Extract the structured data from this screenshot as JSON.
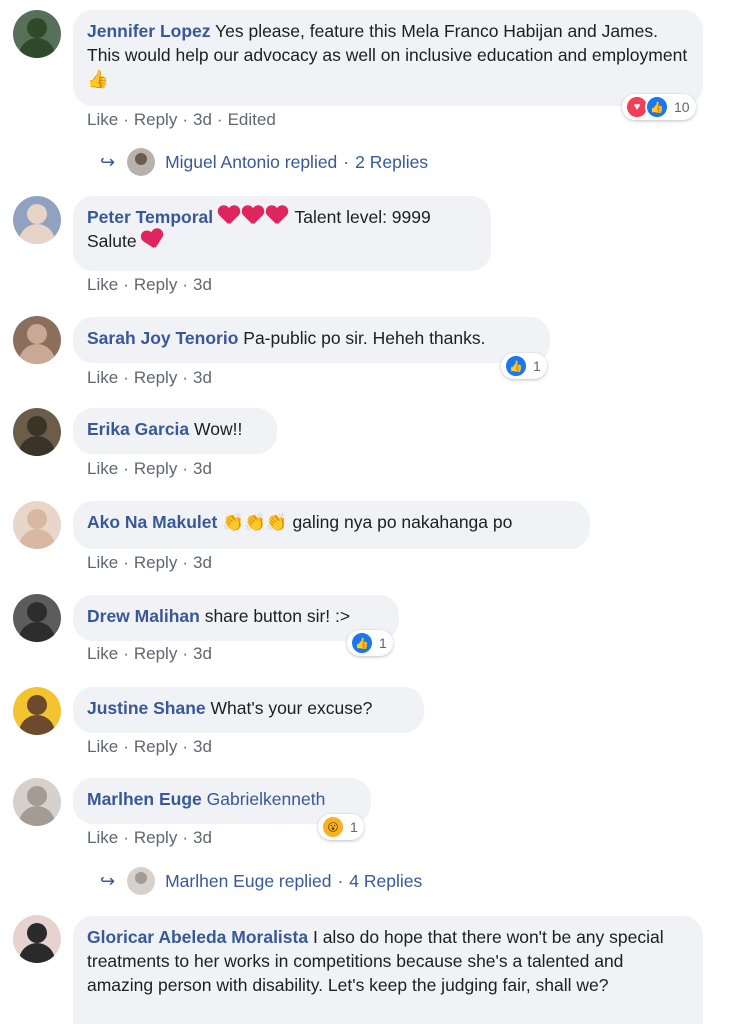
{
  "comments": [
    {
      "author": "Jennifer Lopez",
      "text": "Yes please, feature this Mela Franco Habijan and James. This would help our advocacy as well on inclusive education and employment",
      "emoji_after": "👍",
      "actions": {
        "like": "Like",
        "reply": "Reply",
        "time": "3d",
        "edited": "Edited"
      },
      "reactions": {
        "icons": [
          "love",
          "like"
        ],
        "count": "10"
      },
      "replies": {
        "name": "Miguel Antonio replied",
        "count": "2 Replies"
      },
      "avatar_colors": [
        "#2e4a2a",
        "#58705a"
      ]
    },
    {
      "author": "Peter Temporal",
      "text_parts": [
        "Talent level: 9999",
        "Salute"
      ],
      "actions": {
        "like": "Like",
        "reply": "Reply",
        "time": "3d"
      },
      "avatar_colors": [
        "#e7d3c7",
        "#8fa3c0"
      ]
    },
    {
      "author": "Sarah Joy Tenorio",
      "text": "Pa-public po sir. Heheh thanks.",
      "actions": {
        "like": "Like",
        "reply": "Reply",
        "time": "3d"
      },
      "reactions": {
        "icons": [
          "like"
        ],
        "count": "1"
      },
      "avatar_colors": [
        "#c9a995",
        "#8c6e5d"
      ]
    },
    {
      "author": "Erika Garcia",
      "text": "Wow!!",
      "actions": {
        "like": "Like",
        "reply": "Reply",
        "time": "3d"
      },
      "avatar_colors": [
        "#3a3327",
        "#6b5d4a"
      ]
    },
    {
      "author": "Ako Na Makulet",
      "text": "galing nya po nakahanga po",
      "emoji_before": "👏👏👏",
      "actions": {
        "like": "Like",
        "reply": "Reply",
        "time": "3d"
      },
      "avatar_colors": [
        "#d8b7a3",
        "#e8d6c9"
      ]
    },
    {
      "author": "Drew Malihan",
      "text": "share button sir! :>",
      "actions": {
        "like": "Like",
        "reply": "Reply",
        "time": "3d"
      },
      "reactions": {
        "icons": [
          "like"
        ],
        "count": "1"
      },
      "avatar_colors": [
        "#2d2d2d",
        "#5c5c5c"
      ]
    },
    {
      "author": "Justine Shane",
      "text": "What's your excuse?",
      "actions": {
        "like": "Like",
        "reply": "Reply",
        "time": "3d"
      },
      "avatar_colors": [
        "#6b4a2e",
        "#f4c430"
      ]
    },
    {
      "author": "Marlhen Euge",
      "text": "Gabrielkenneth",
      "text_is_link": true,
      "actions": {
        "like": "Like",
        "reply": "Reply",
        "time": "3d"
      },
      "reactions": {
        "icons": [
          "wow"
        ],
        "count": "1"
      },
      "replies": {
        "name": "Marlhen Euge replied",
        "count": "4 Replies"
      },
      "avatar_colors": [
        "#a39b94",
        "#d6d1cc"
      ]
    },
    {
      "author": "Gloricar Abeleda Moralista",
      "text": "I also do hope that there won't be any special treatments to her works in competitions because she's a talented and amazing person with disability. Let's keep the judging fair, shall we?",
      "avatar_colors": [
        "#2a2a2a",
        "#e6d3cf"
      ]
    }
  ],
  "icons": {
    "reply_arrow": "reply-arrow-icon",
    "like": "like-reaction-icon",
    "love": "love-reaction-icon",
    "wow": "wow-reaction-icon"
  },
  "colors": {
    "author": "#385898",
    "bubble": "#f0f2f5",
    "meta": "#606770",
    "like": "#1877f2",
    "love": "#f33e58",
    "wow": "#f7b125"
  },
  "glyphs": {
    "thumb": "👍",
    "like": "👍",
    "love": "♥",
    "wow": "😮",
    "arrow": "↪",
    "sep": "·"
  }
}
